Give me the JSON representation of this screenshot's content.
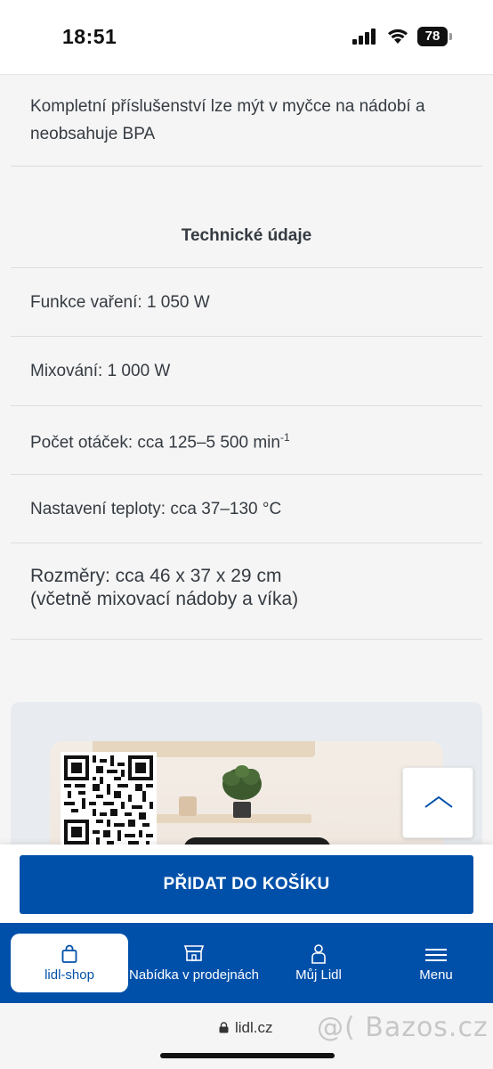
{
  "status_bar": {
    "time": "18:51",
    "battery": "78"
  },
  "description": {
    "text": "Kompletní příslušenství lze mýt v myčce na nádobí a neobsahuje BPA"
  },
  "specs": {
    "title": "Technické údaje",
    "rows": [
      "Funkce vaření: 1 050 W",
      "Mixování: 1 000 W",
      "Počet otáček: cca 125–5 500 min",
      "Nastavení teploty: cca 37–130 °C",
      "Rozměry: cca 46 x 37 x 29 cm",
      "(včetně mixovací nádoby a víka)"
    ],
    "speed_unit_exponent": "-1"
  },
  "cart": {
    "button_label": "PŘIDAT DO KOŠÍKU"
  },
  "nav": {
    "items": [
      {
        "label": "lidl-shop",
        "icon": "shopping-bag-icon",
        "active": true
      },
      {
        "label": "Nabídka v prodejnách",
        "icon": "store-icon",
        "active": false
      },
      {
        "label": "Můj Lidl",
        "icon": "user-icon",
        "active": false
      },
      {
        "label": "Menu",
        "icon": "hamburger-menu-icon",
        "active": false
      }
    ]
  },
  "browser": {
    "url": "lidl.cz",
    "watermark": "@( Bazos.cz"
  },
  "colors": {
    "brand_blue": "#0050aa",
    "background": "#f5f5f5",
    "text": "#353b42"
  }
}
